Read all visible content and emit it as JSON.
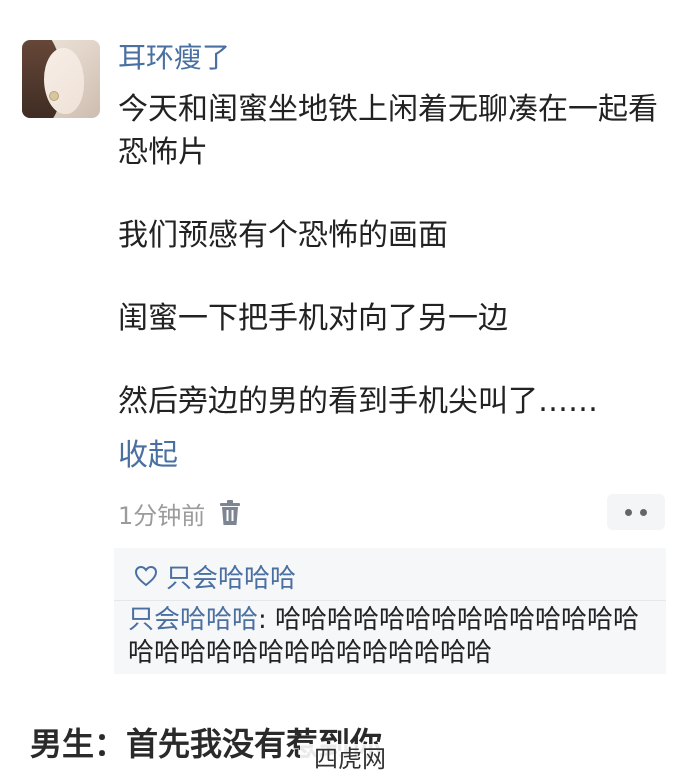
{
  "post": {
    "username": "耳环瘦了",
    "content": {
      "line1": "今天和闺蜜坐地铁上闲着无聊凑在一起看恐怖片",
      "line2": "我们预感有个恐怖的画面",
      "line3": "闺蜜一下把手机对向了另一边",
      "line4": "然后旁边的男的看到手机尖叫了……"
    },
    "collapse_label": "收起",
    "timestamp": "1分钟前"
  },
  "reply": {
    "liked_by": "只会哈哈哈",
    "author": "只会哈哈哈",
    "separator": ": ",
    "text": "哈哈哈哈哈哈哈哈哈哈哈哈哈哈哈哈哈哈哈哈哈哈哈哈哈哈哈哈"
  },
  "caption": "男生：首先我没有惹到你",
  "watermark": "四虎网",
  "colors": {
    "link": "#4a6fa1",
    "text": "#222222",
    "meta": "#9b9b9b",
    "reply_bg": "#f6f7f9"
  },
  "icons": {
    "delete": "trash-icon",
    "more": "more-icon",
    "like": "heart-icon"
  }
}
